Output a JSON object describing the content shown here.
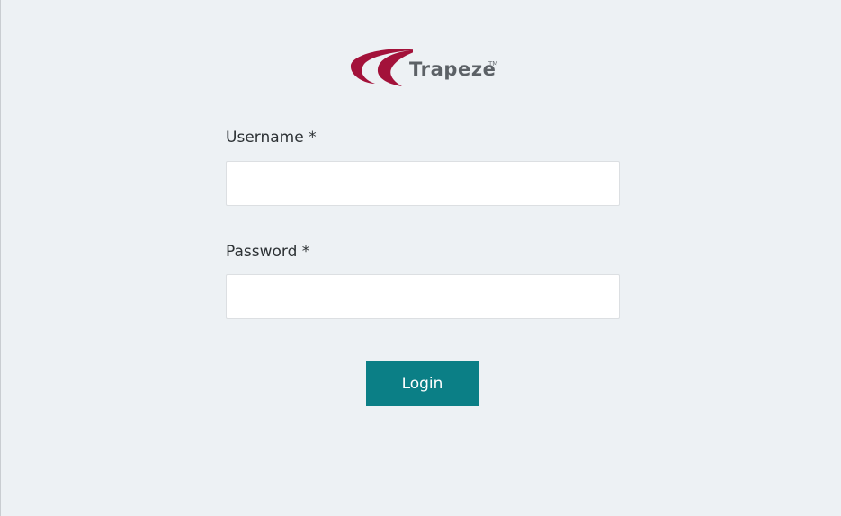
{
  "logo": {
    "brand": "Trapeze",
    "trademark": "TM",
    "icon": "trapeze-swoosh-icon"
  },
  "form": {
    "username": {
      "label": "Username *",
      "value": "",
      "placeholder": ""
    },
    "password": {
      "label": "Password *",
      "value": "",
      "placeholder": ""
    },
    "login_label": "Login"
  },
  "colors": {
    "background": "#edf1f4",
    "accent": "#0b7f86",
    "logo_red": "#a3123a",
    "text": "#2d3235",
    "input_border": "#dcdfe2"
  }
}
